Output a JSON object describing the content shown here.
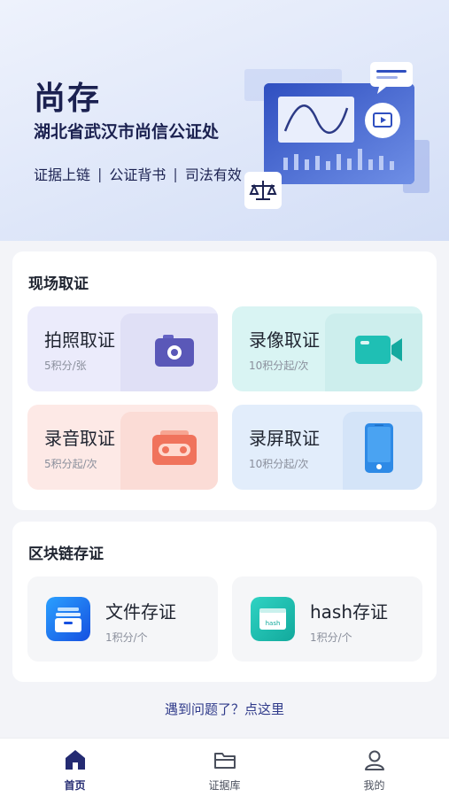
{
  "hero": {
    "title": "尚存",
    "subtitle": "湖北省武汉市尚信公证处",
    "tags": [
      "证据上链",
      "公证背书",
      "司法有效"
    ]
  },
  "scene": {
    "title": "现场取证",
    "tiles": [
      {
        "label": "拍照取证",
        "price": "5积分/张",
        "icon": "camera-icon"
      },
      {
        "label": "录像取证",
        "price": "10积分起/次",
        "icon": "video-camera-icon"
      },
      {
        "label": "录音取证",
        "price": "5积分起/次",
        "icon": "cassette-icon"
      },
      {
        "label": "录屏取证",
        "price": "10积分起/次",
        "icon": "phone-icon"
      }
    ]
  },
  "blockchain": {
    "title": "区块链存证",
    "tiles": [
      {
        "label": "文件存证",
        "price": "1积分/个",
        "icon": "file-box-icon"
      },
      {
        "label": "hash存证",
        "price": "1积分/个",
        "icon": "hash-card-icon",
        "icon_text": "hash"
      }
    ]
  },
  "help_link": "遇到问题了？点这里",
  "tabbar": {
    "items": [
      {
        "label": "首页",
        "icon": "home-icon",
        "active": true
      },
      {
        "label": "证据库",
        "icon": "folder-icon",
        "active": false
      },
      {
        "label": "我的",
        "icon": "user-icon",
        "active": false
      }
    ]
  },
  "colors": {
    "brand": "#242b72",
    "photo": "#5a58b8",
    "video": "#1fbfb4",
    "audio": "#f0735c",
    "screen": "#2e8ae6"
  }
}
